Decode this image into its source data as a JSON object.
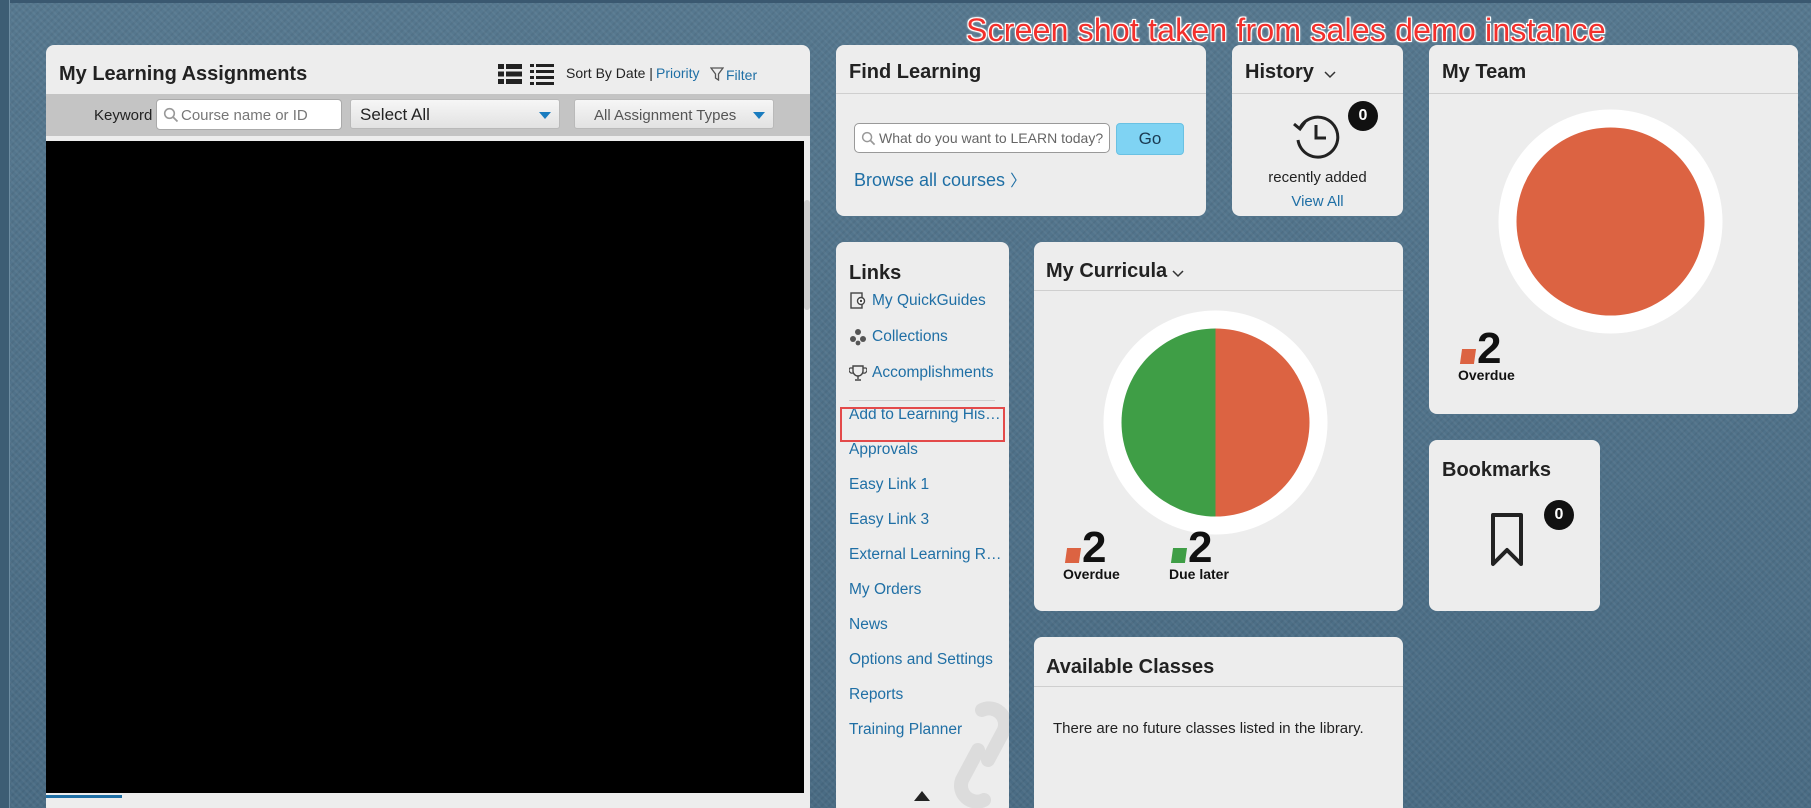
{
  "banner": "Screen shot taken from sales demo instance",
  "colors": {
    "overdue": "#dc6342",
    "due_later": "#3f9e46",
    "link": "#1f6fa5",
    "badge": "#111111",
    "go_button": "#7fd3f3"
  },
  "assignments": {
    "title": "My Learning Assignments",
    "view_icons": [
      "list-view-icon",
      "detail-list-view-icon"
    ],
    "sort_prefix": "Sort By Date |",
    "sort_priority": "Priority",
    "filter_label": "Filter",
    "keyword_label": "Keyword",
    "search_placeholder": "Course name or ID",
    "select_value": "Select All",
    "type_value": "All Assignment Types"
  },
  "find_learning": {
    "title": "Find Learning",
    "search_placeholder": "What do you want to LEARN today?",
    "go_label": "Go",
    "browse_label": "Browse all courses"
  },
  "history": {
    "title": "History",
    "count": "0",
    "caption": "recently added",
    "view_all": "View All"
  },
  "team": {
    "title": "My Team",
    "overdue_count": "2",
    "overdue_label": "Overdue",
    "chart_data": {
      "type": "pie",
      "labels": [
        "Overdue"
      ],
      "values": [
        2
      ]
    }
  },
  "links": {
    "title": "Links",
    "items": [
      {
        "label": "My QuickGuides",
        "icon": "quickguide-icon"
      },
      {
        "label": "Collections",
        "icon": "collections-icon"
      },
      {
        "label": "Accomplishments",
        "icon": "trophy-icon"
      },
      {
        "label": "Add to Learning His…"
      },
      {
        "label": "Approvals"
      },
      {
        "label": "Easy Link 1"
      },
      {
        "label": "Easy Link 3"
      },
      {
        "label": "External Learning R…"
      },
      {
        "label": "My Orders"
      },
      {
        "label": "News"
      },
      {
        "label": "Options and Settings"
      },
      {
        "label": "Reports"
      },
      {
        "label": "Training Planner"
      }
    ]
  },
  "curricula": {
    "title": "My Curricula",
    "overdue_count": "2",
    "overdue_label": "Overdue",
    "due_count": "2",
    "due_label": "Due later",
    "chart_data": {
      "type": "pie",
      "labels": [
        "Overdue",
        "Due later"
      ],
      "values": [
        2,
        2
      ]
    }
  },
  "bookmarks": {
    "title": "Bookmarks",
    "count": "0"
  },
  "classes": {
    "title": "Available Classes",
    "message": "There are no future classes listed in the library."
  }
}
